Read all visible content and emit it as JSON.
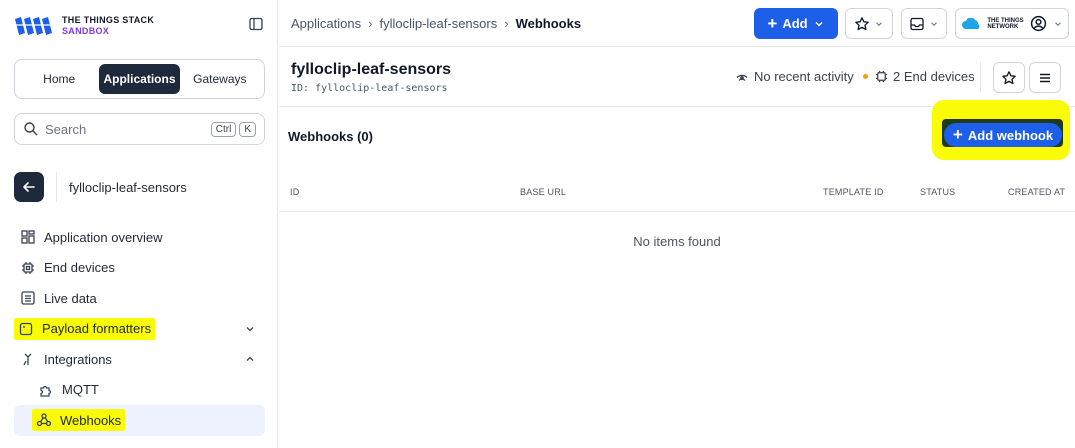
{
  "brand": {
    "line1": "THE THINGS STACK",
    "line2": "SANDBOX"
  },
  "switcher": {
    "home": "Home",
    "applications": "Applications",
    "gateways": "Gateways"
  },
  "search": {
    "placeholder": "Search",
    "key1": "Ctrl",
    "key2": "K"
  },
  "app": {
    "name": "fylloclip-leaf-sensors",
    "id": "ID: fylloclip-leaf-sensors"
  },
  "nav": {
    "overview": "Application overview",
    "end_devices": "End devices",
    "live_data": "Live data",
    "payload_formatters": "Payload formatters",
    "integrations": "Integrations",
    "mqtt": "MQTT",
    "webhooks": "Webhooks"
  },
  "breadcrumbs": [
    "Applications",
    "fylloclip-leaf-sensors",
    "Webhooks"
  ],
  "header": {
    "add_label": "Add",
    "network_line1": "THE THINGS",
    "network_line2": "NETWORK"
  },
  "status": {
    "activity": "No recent activity",
    "devices": "2 End devices"
  },
  "webhooks": {
    "title": "Webhooks (0)",
    "add_label": "Add webhook",
    "empty": "No items found"
  },
  "table": {
    "columns": [
      "ID",
      "BASE URL",
      "TEMPLATE ID",
      "STATUS",
      "CREATED AT"
    ]
  },
  "colors": {
    "primary": "#1d5fe8",
    "dark": "#1e293b",
    "highlight": "#fafb06",
    "accent": "#7c3aed"
  }
}
